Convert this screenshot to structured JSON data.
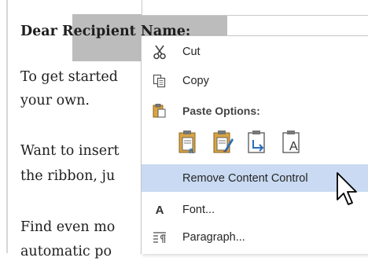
{
  "document": {
    "salutation": "Dear Recipient Name:",
    "line1": "To get started",
    "line2": "your own.",
    "line3": "Want to insert",
    "line4": "the ribbon, ju",
    "line5": "Find even mo",
    "line6": "automatic po"
  },
  "context_menu": {
    "cut": {
      "label": "Cut",
      "icon": "scissors-icon"
    },
    "copy": {
      "label": "Copy",
      "icon": "copy-icon"
    },
    "paste_options": {
      "label": "Paste Options:",
      "icon": "clipboard-icon"
    },
    "paste_buttons": [
      {
        "icon": "paste-keep-source-formatting-icon"
      },
      {
        "icon": "paste-merge-formatting-icon"
      },
      {
        "icon": "paste-picture-icon"
      },
      {
        "icon": "paste-keep-text-only-icon",
        "glyph": "A"
      }
    ],
    "remove_content_control": {
      "label": "Remove Content Control"
    },
    "font": {
      "label": "Font...",
      "icon_glyph": "A"
    },
    "paragraph": {
      "label": "Paragraph...",
      "icon": "paragraph-icon"
    }
  },
  "colors": {
    "highlight": "#c9daf2",
    "content_control": "#bcbcbc",
    "paste_gold": "#d9a441",
    "paste_blue": "#2a6cb8"
  }
}
